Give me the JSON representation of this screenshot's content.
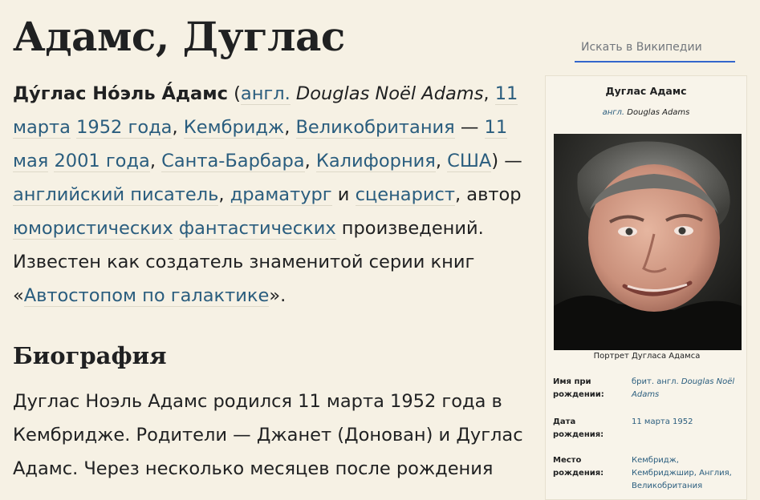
{
  "page": {
    "title": "Адамс, Дуглас"
  },
  "search": {
    "placeholder": "Искать в Википедии"
  },
  "lead": {
    "name_bold": "Ду́глас Но́эль А́дамс",
    "open_paren": " (",
    "lang_link": "англ.",
    "orig_name": " Douglas Noël Adams",
    "sep1": ", ",
    "born_day": "11 марта",
    "sp1": " ",
    "born_year": "1952 года",
    "sep2": ", ",
    "born_city": "Кембридж",
    "sep3": ", ",
    "born_country": "Великобритания",
    "dash1": " — ",
    "died_day": "11 мая",
    "sp2": " ",
    "died_year": "2001 года",
    "sep4": ", ",
    "died_city": "Санта-Барбара",
    "sep5": ", ",
    "died_state": "Калифорния",
    "sep6": ", ",
    "died_country": "США",
    "close_paren": ") — ",
    "writer": "английский писатель",
    "sep7": ", ",
    "dramatist": "драматург",
    "and": " и ",
    "screenwriter": "сценарист",
    "author_of": ", автор ",
    "humorous": "юмористических",
    "sp3": " ",
    "fantastic": "фантастических",
    "works": " произведений. Известен как создатель знаменитой серии книг «",
    "series": "Автостопом по галактике",
    "end": "»."
  },
  "biography": {
    "heading": "Биография",
    "text": "Дуглас Ноэль Адамс родился 11 марта 1952 года в Кембридже. Родители — Джанет (Донован) и Дуглас Адамс. Через несколько месяцев после рождения"
  },
  "infobox": {
    "name": "Дуглас Адамс",
    "orig_lang": "англ.",
    "orig_name": " Douglas Adams",
    "photo_caption": "Портрет Дугласа Адамса",
    "rows": [
      {
        "label": "Имя при рождении:",
        "value_prefix": "брит. англ. ",
        "value": "Douglas Noël Adams"
      },
      {
        "label": "Дата рождения:",
        "value": "11 марта 1952"
      },
      {
        "label": "Место рождения:",
        "value": "Кембридж, Кембриджшир, Англия, Великобритания"
      }
    ]
  },
  "colors": {
    "link": "#2a5d7e",
    "background": "#f6f1e4",
    "search_underline": "#3366cc"
  }
}
